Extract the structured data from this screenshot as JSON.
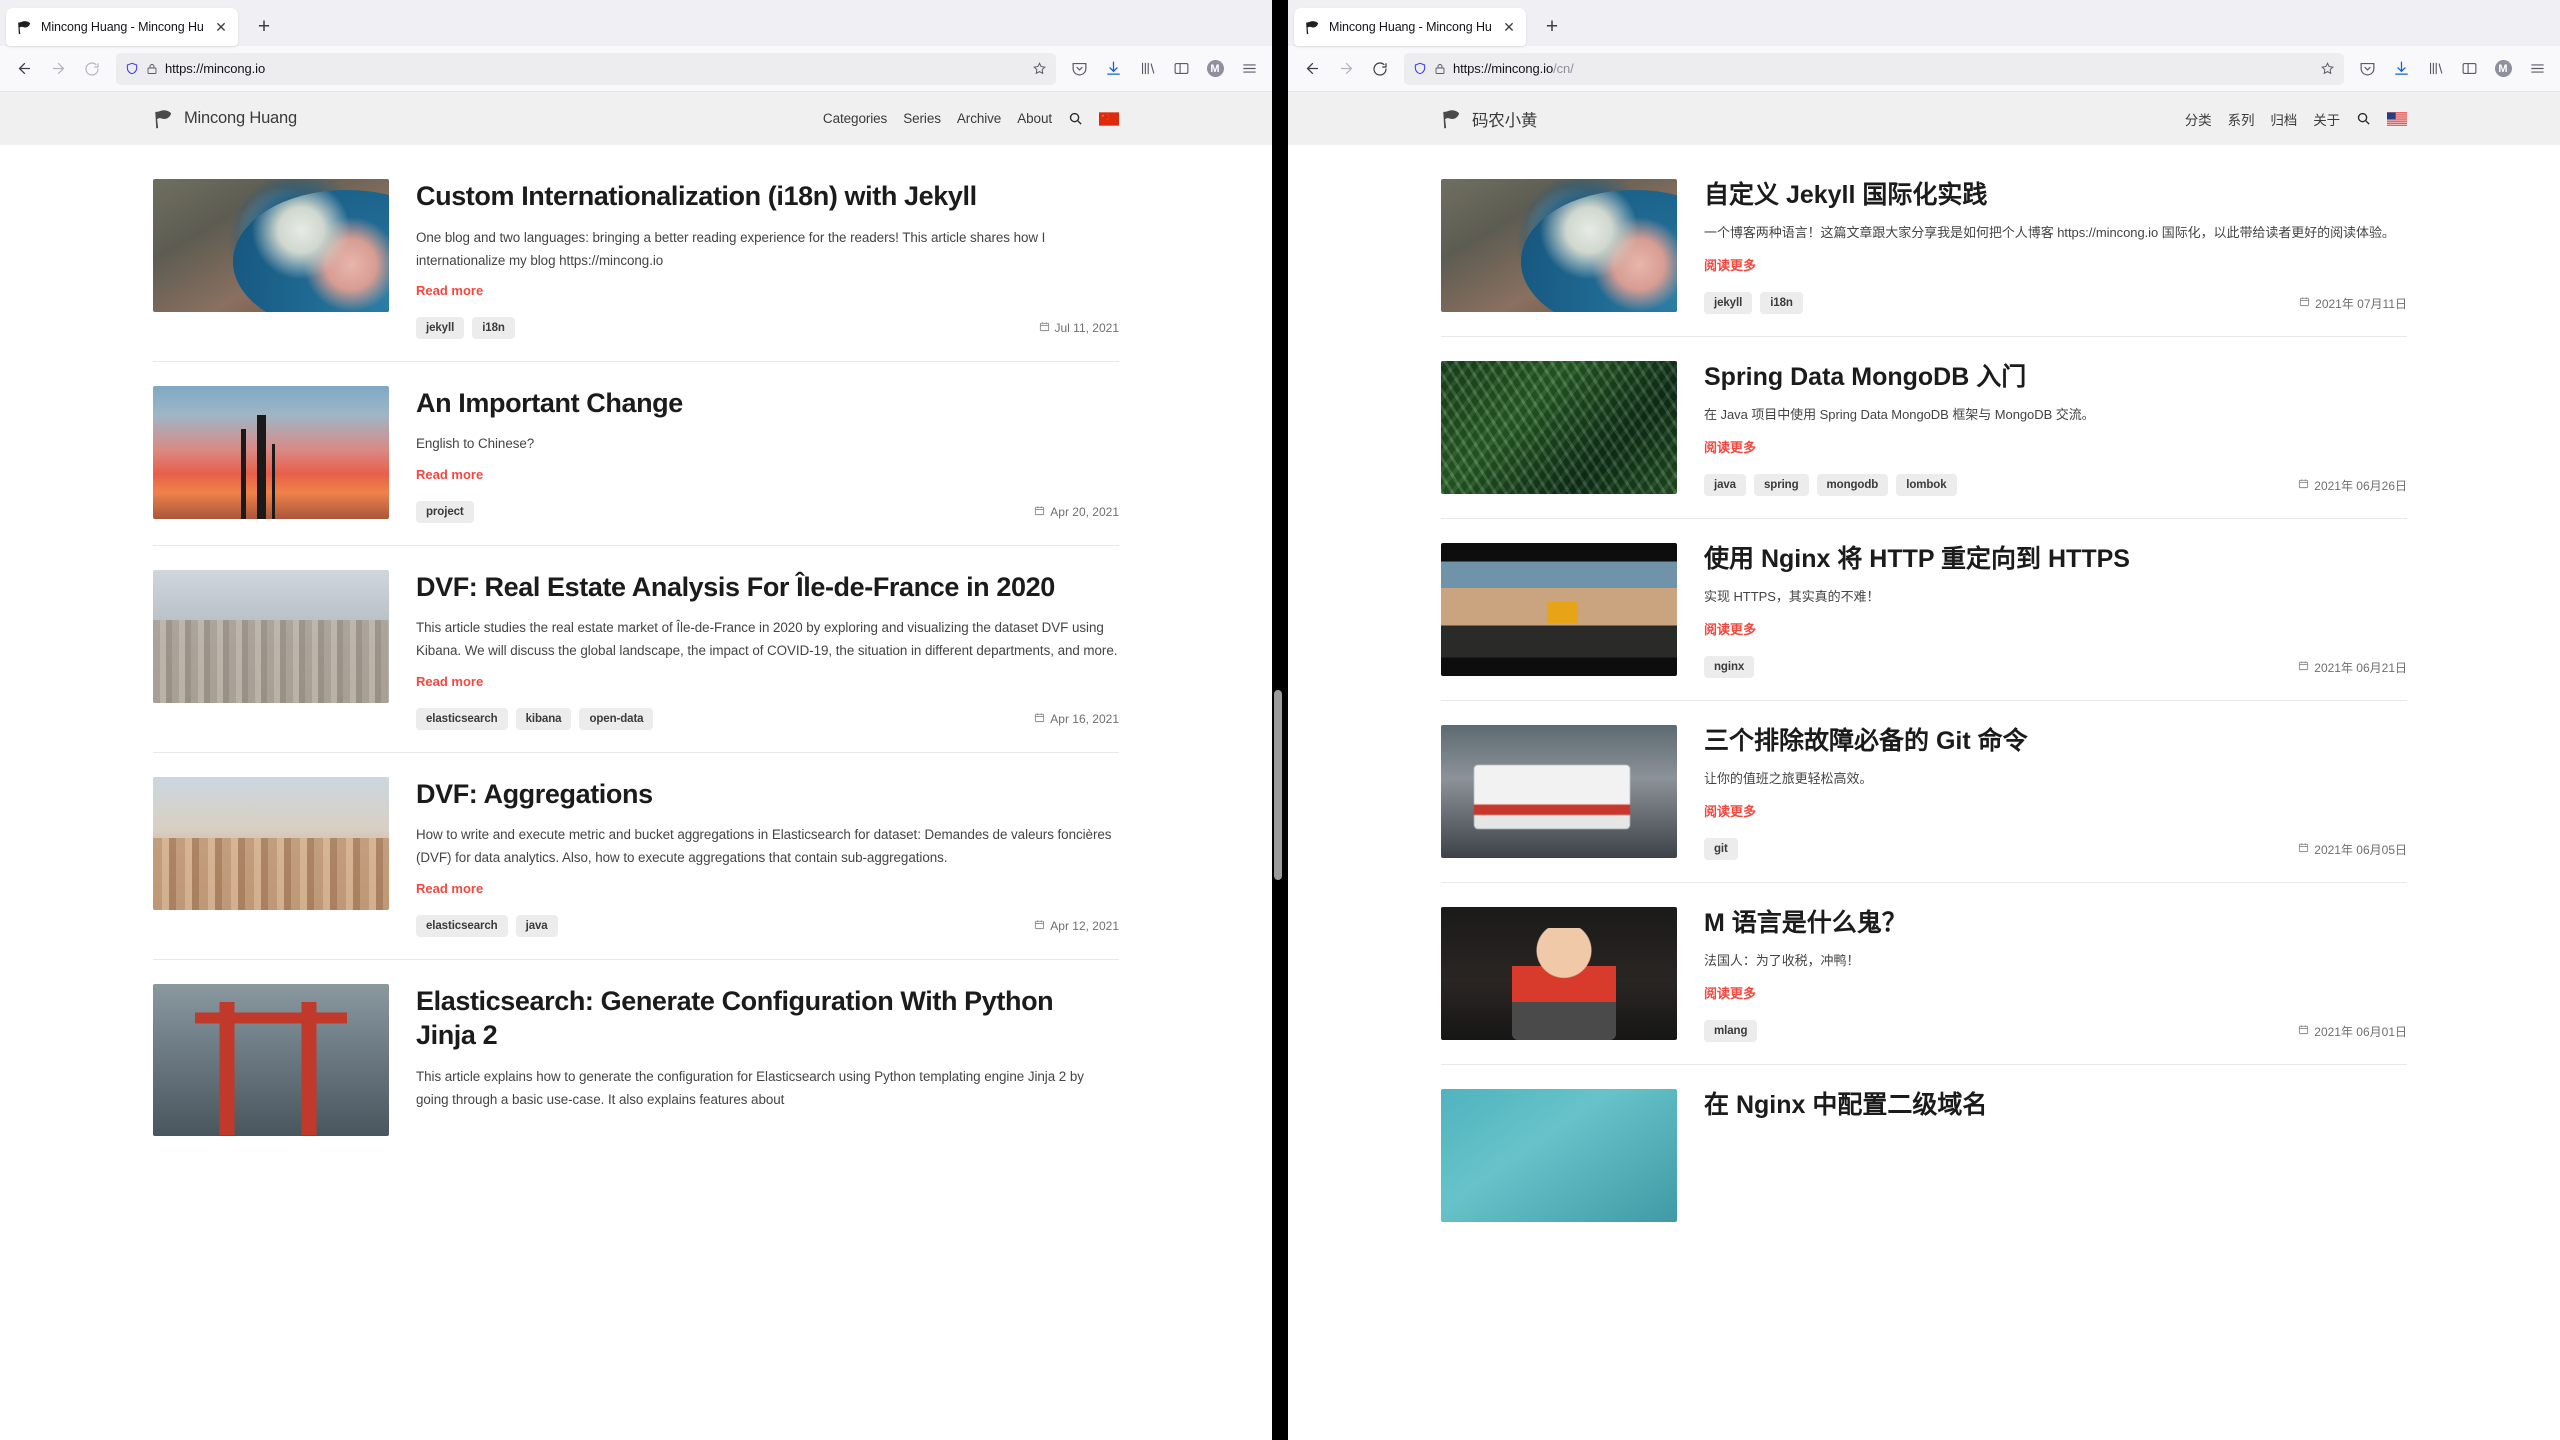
{
  "browsers": {
    "left": {
      "tab": {
        "title": "Mincong Huang - Mincong Huan",
        "close_label": "✕"
      },
      "newtab_label": "+",
      "url": "https://mincong.io",
      "url_path": "",
      "toolbar_icons": [
        "pocket-icon",
        "download-icon",
        "library-icon",
        "sidebar-icon",
        "account-icon",
        "menu-icon"
      ],
      "account_initial": "M"
    },
    "right": {
      "tab": {
        "title": "Mincong Huang - Mincong Huan",
        "close_label": "✕"
      },
      "newtab_label": "+",
      "url": "https://mincong.io",
      "url_path": "/cn/",
      "toolbar_icons": [
        "pocket-icon",
        "download-icon",
        "library-icon",
        "sidebar-icon",
        "account-icon",
        "menu-icon"
      ],
      "account_initial": "M"
    }
  },
  "site_en": {
    "brand": "Mincong Huang",
    "nav": [
      "Categories",
      "Series",
      "Archive",
      "About"
    ],
    "language_flag": "🇨🇳",
    "read_more": "Read more",
    "posts": [
      {
        "title": "Custom Internationalization (i18n) with Jekyll",
        "excerpt": "One blog and two languages: bringing a better reading experience for the readers! This article shares how I internationalize my blog https://mincong.io",
        "tags": [
          "jekyll",
          "i18n"
        ],
        "date": "Jul 11, 2021",
        "thumb": "img-globe"
      },
      {
        "title": "An Important Change",
        "excerpt": "English to Chinese?",
        "tags": [
          "project"
        ],
        "date": "Apr 20, 2021",
        "thumb": "img-sunset"
      },
      {
        "title": "DVF: Real Estate Analysis For Île-de-France in 2020",
        "excerpt": "This article studies the real estate market of Île-de-France in 2020 by exploring and visualizing the dataset DVF using Kibana. We will discuss the global landscape, the impact of COVID-19, the situation in different departments, and more.",
        "tags": [
          "elasticsearch",
          "kibana",
          "open-data"
        ],
        "date": "Apr 16, 2021",
        "thumb": "img-paris"
      },
      {
        "title": "DVF: Aggregations",
        "excerpt": "How to write and execute metric and bucket aggregations in Elasticsearch for dataset: Demandes de valeurs foncières (DVF) for data analytics. Also, how to execute aggregations that contain sub-aggregations.",
        "tags": [
          "elasticsearch",
          "java"
        ],
        "date": "Apr 12, 2021",
        "thumb": "img-montmartre"
      },
      {
        "title": "Elasticsearch: Generate Configuration With Python Jinja 2",
        "excerpt": "This article explains how to generate the configuration for Elasticsearch using Python templating engine Jinja 2 by going through a basic use-case. It also explains features about",
        "tags": [],
        "date": "",
        "thumb": "img-torii"
      }
    ]
  },
  "site_cn": {
    "brand": "码农小黄",
    "nav": [
      "分类",
      "系列",
      "归档",
      "关于"
    ],
    "language_flag": "🇺🇸",
    "read_more": "阅读更多",
    "posts": [
      {
        "title": "自定义 Jekyll 国际化实践",
        "excerpt": "一个博客两种语言！这篇文章跟大家分享我是如何把个人博客 https://mincong.io 国际化，以此带给读者更好的阅读体验。",
        "tags": [
          "jekyll",
          "i18n"
        ],
        "date": "2021年 07月11日",
        "thumb": "img-globe"
      },
      {
        "title": "Spring Data MongoDB 入门",
        "excerpt": "在 Java 项目中使用 Spring Data MongoDB 框架与 MongoDB 交流。",
        "tags": [
          "java",
          "spring",
          "mongodb",
          "lombok"
        ],
        "date": "2021年 06月26日",
        "thumb": "img-fern"
      },
      {
        "title": "使用 Nginx 将 HTTP 重定向到 HTTPS",
        "excerpt": "实现 HTTPS，其实真的不难！",
        "tags": [
          "nginx"
        ],
        "date": "2021年 06月21日",
        "thumb": "img-desert"
      },
      {
        "title": "三个排除故障必备的 Git 命令",
        "excerpt": "让你的值班之旅更轻松高效。",
        "tags": [
          "git"
        ],
        "date": "2021年 06月05日",
        "thumb": "img-ambulance"
      },
      {
        "title": "M 语言是什么鬼？",
        "excerpt": "法国人：为了收税，冲鸭！",
        "tags": [
          "mlang"
        ],
        "date": "2021年 06月01日",
        "thumb": "img-kid"
      },
      {
        "title": "在 Nginx 中配置二级域名",
        "excerpt": "",
        "tags": [],
        "date": "",
        "thumb": "img-teal"
      }
    ]
  },
  "colors": {
    "accent_red": "#f4473f",
    "header_bg": "#f0f0f0",
    "tag_bg": "#ececec",
    "divider_black": "#000000"
  }
}
